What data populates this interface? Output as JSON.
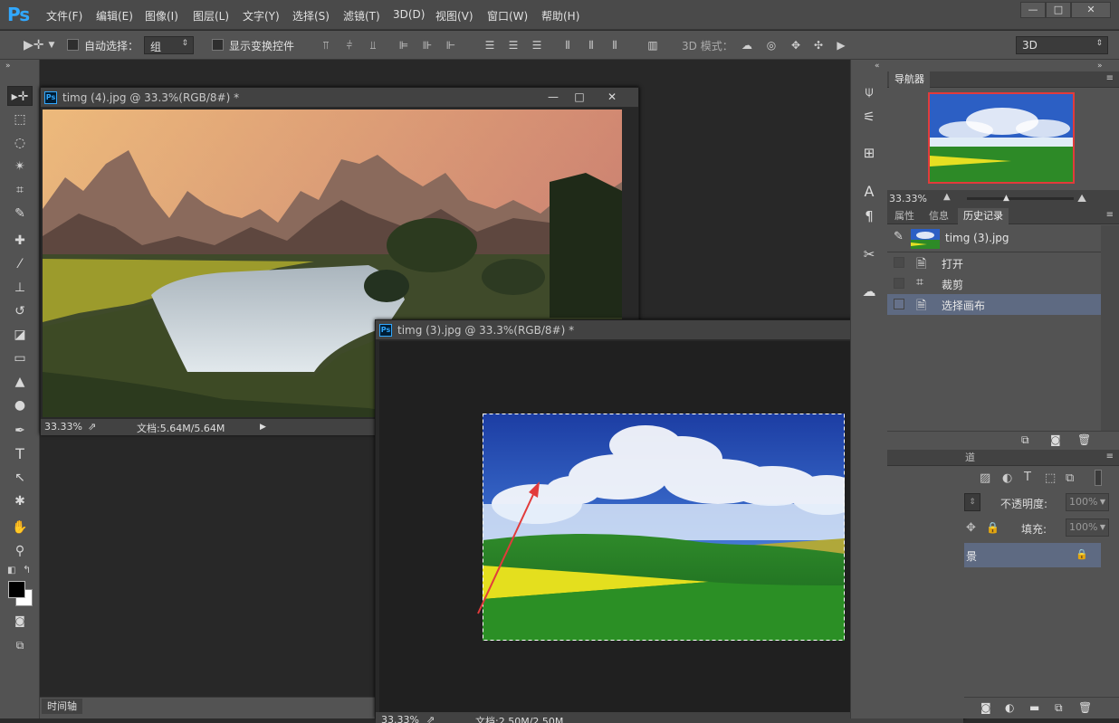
{
  "app": {
    "logo": "Ps"
  },
  "menu": [
    "文件(F)",
    "编辑(E)",
    "图像(I)",
    "图层(L)",
    "文字(Y)",
    "选择(S)",
    "滤镜(T)",
    "3D(D)",
    "视图(V)",
    "窗口(W)",
    "帮助(H)"
  ],
  "window_controls": {
    "minimize": "—",
    "maximize": "□",
    "close": "✕"
  },
  "options": {
    "auto_select_label": "自动选择：",
    "auto_select_value": "组",
    "show_transform_label": "显示变换控件",
    "mode_3d_label": "3D 模式：",
    "workspace_value": "3D"
  },
  "doc1": {
    "title": "timg (4).jpg @ 33.3%(RGB/8#) *",
    "zoom": "33.33%",
    "doc_size": "文档:5.64M/5.64M"
  },
  "doc2": {
    "title": "timg (3).jpg @ 33.3%(RGB/8#) *",
    "zoom": "33.33%",
    "doc_size": "文档:2.50M/2.50M"
  },
  "timeline_label": "时间轴",
  "navigator": {
    "tab": "导航器",
    "zoom": "33.33%"
  },
  "history_panel": {
    "tabs": [
      "属性",
      "信息",
      "历史记录"
    ],
    "snapshot_name": "timg (3).jpg",
    "items": [
      {
        "label": "打开",
        "icon": "document-icon"
      },
      {
        "label": "裁剪",
        "icon": "crop-icon"
      },
      {
        "label": "选择画布",
        "icon": "document-icon"
      }
    ]
  },
  "layers_panel": {
    "tab_fragment": "道",
    "opacity_label": "不透明度:",
    "opacity_value": "100%",
    "fill_label": "填充:",
    "fill_value": "100%",
    "layer_fragment": "景"
  }
}
